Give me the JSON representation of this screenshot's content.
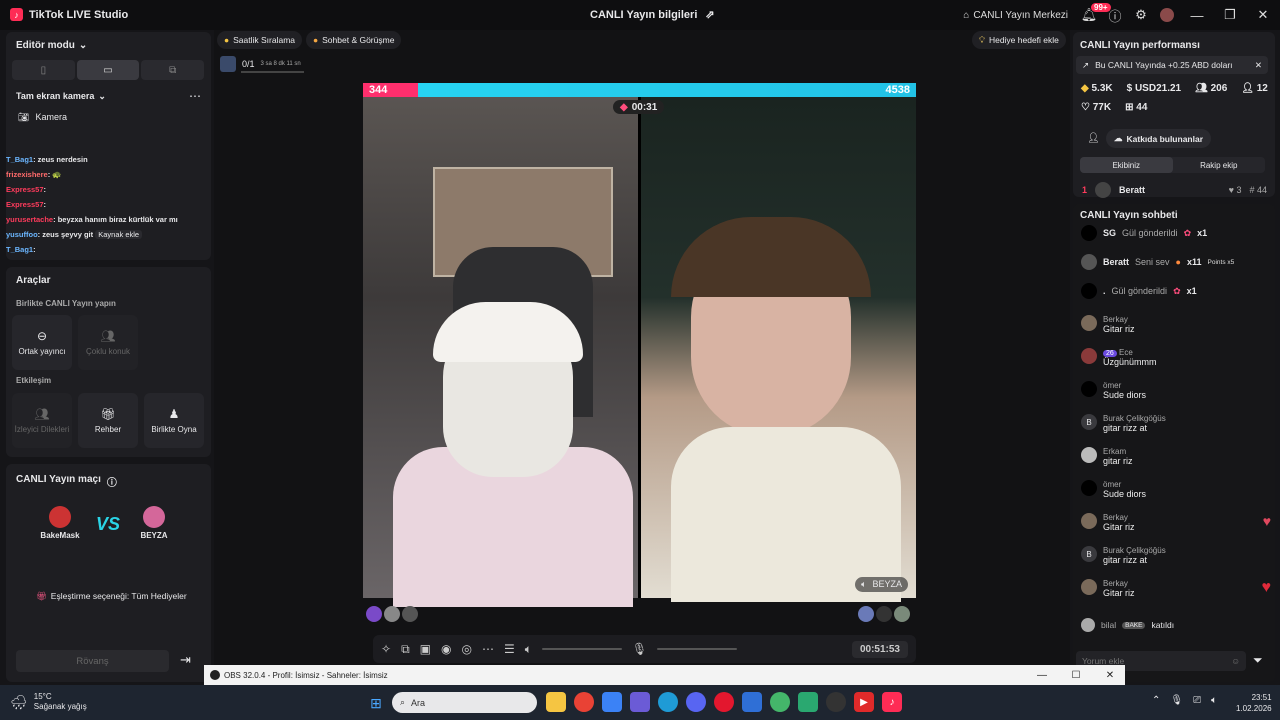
{
  "app": {
    "title": "TikTok LIVE Studio",
    "center_title": "CANLI Yayın bilgileri",
    "live_center": "CANLI Yayın Merkezi",
    "notif_count": "99+"
  },
  "left": {
    "editor_mode": "Editör modu",
    "camera_source": "Tam ekran kamera",
    "camera_label": "Kamera",
    "chat": [
      {
        "user": "T_Bag1",
        "text": ": zeus nerdesin",
        "color": "#6bb6ff"
      },
      {
        "user": "frizexishere",
        "text": ":",
        "color": "#ff6b6b"
      },
      {
        "user": "Express57",
        "text": ":",
        "color": "#ff3b5c"
      },
      {
        "user": "Express57",
        "text": ":",
        "color": "#ff3b5c"
      },
      {
        "user": "yurusertache",
        "text": ": beyzxa hanım biraz kürtlük var mı",
        "color": "#ff3b5c"
      },
      {
        "user": "yusuffoo",
        "text": ": zeus şeyvy git",
        "color": "#6bb6ff"
      },
      {
        "user": "T_Bag1",
        "text": ":",
        "color": "#6bb6ff"
      }
    ],
    "chat_overlay": "Kaynak ekle",
    "tools_title": "Araçlar",
    "collab_title": "Birlikte CANLI Yayın yapın",
    "tool_cohost": "Ortak yayıncı",
    "tool_multi": "Çoklu konuk",
    "interaction_title": "Etkileşim",
    "tool_viewer_wishes": "İzleyici Dilekleri",
    "tool_guide": "Rehber",
    "tool_play": "Birlikte Oyna",
    "match_title": "CANLI Yayın maçı",
    "player1": "BakeMask",
    "player2": "BEYZA",
    "vs": "VS",
    "match_option": "Eşleştirme seçeneği: Tüm Hediyeler",
    "rematch": "Rövanş"
  },
  "main": {
    "pill1": "Saatlik Sıralama",
    "pill2": "Sohbet & Görüşme",
    "pill3": "Hediye hedefi ekle",
    "goal_progress": "0/1",
    "goal_time": "3 sa 8 dk 11 sn",
    "score_left": "344",
    "score_right": "4538",
    "battle_timer": "00:31",
    "cam_right_label": "BEYZA",
    "duration": "00:51:53"
  },
  "right": {
    "perf_title": "CANLI Yayın performansı",
    "earn_note": "Bu CANLI Yayında +0.25 ABD doları",
    "stat1": "5.3K",
    "stat2": "USD21.21",
    "stat3": "206",
    "stat4": "12",
    "stat5": "77K",
    "stat6": "44",
    "contributors": "Katkıda bulunanlar",
    "tab_ours": "Ekibiniz",
    "tab_rival": "Rakip ekip",
    "rank_num": "1",
    "rank_name": "Beratt",
    "rank_hearts": "3",
    "rank_points": "44",
    "chat_title": "CANLI Yayın sohbeti",
    "gifts": [
      {
        "user": "SG",
        "text": "Gül gönderildi",
        "mult": "x1"
      },
      {
        "user": "Beratt",
        "text": "Seni sev",
        "mult": "x11",
        "extra": "Points x5"
      },
      {
        "user": ".",
        "text": "Gül gönderildi",
        "mult": "x1"
      }
    ],
    "messages": [
      {
        "name": "Berkay",
        "text": "Gitar riz"
      },
      {
        "name": "Ece",
        "text": "Üzgünümmm",
        "badge": "26"
      },
      {
        "name": "ömer",
        "text": "Sude diors"
      },
      {
        "name": "Burak Çelikgöğüs",
        "text": "gitar rizz at"
      },
      {
        "name": "Erkam",
        "text": "gitar riz"
      },
      {
        "name": "ömer",
        "text": "Sude diors"
      },
      {
        "name": "Berkay",
        "text": "Gitar riz"
      },
      {
        "name": "Burak Çelikgöğüs",
        "text": "gitar rizz at"
      },
      {
        "name": "Berkay",
        "text": "Gitar riz"
      }
    ],
    "join_user": "bilal",
    "join_badge": "BAKE",
    "join_text": "katıldı",
    "comment_placeholder": "Yorum ekle"
  },
  "obs": {
    "title": "OBS 32.0.4 - Profil: İsimsiz - Sahneler: İsimsiz"
  },
  "taskbar": {
    "temp": "15°C",
    "weather": "Sağanak yağış",
    "search": "Ara",
    "time": "23:51",
    "date": "1.02.2026"
  }
}
